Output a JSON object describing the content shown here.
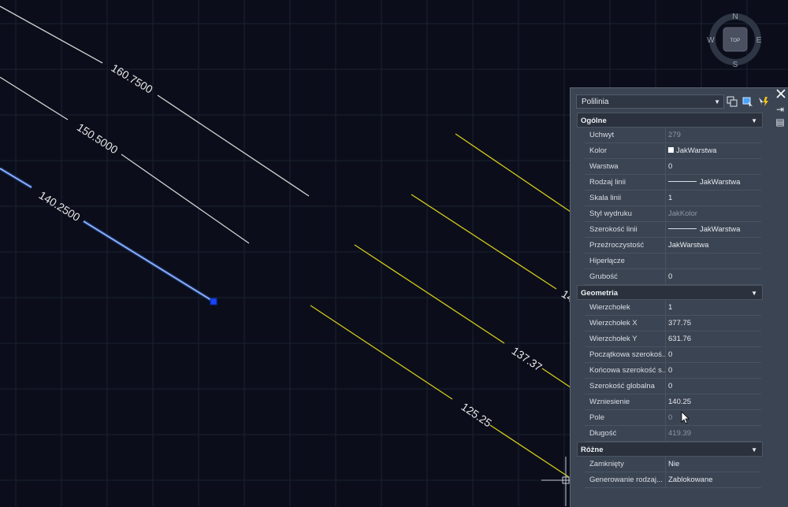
{
  "drawing": {
    "white_labels": [
      "160.7500",
      "150.5000",
      "140.2500"
    ],
    "yellow_labels": [
      "137.37",
      "125.25",
      "14"
    ]
  },
  "viewcube": {
    "north": "N",
    "south": "S",
    "east": "E",
    "west": "W",
    "face": "TOP"
  },
  "palette": {
    "object_type": "Polilinia",
    "sections": [
      {
        "title": "Ogólne",
        "rows": [
          {
            "name": "Uchwyt",
            "value": "279",
            "dim": true
          },
          {
            "name": "Kolor",
            "value": "JakWarstwa",
            "swatch": "#ffffff"
          },
          {
            "name": "Warstwa",
            "value": "0"
          },
          {
            "name": "Rodzaj linii",
            "value": "JakWarstwa",
            "line": true
          },
          {
            "name": "Skala linii",
            "value": "1"
          },
          {
            "name": "Styl wydruku",
            "value": "JakKolor",
            "dim": true
          },
          {
            "name": "Szerokość linii",
            "value": "JakWarstwa",
            "line": true
          },
          {
            "name": "Przeźroczystość",
            "value": "JakWarstwa"
          },
          {
            "name": "Hiperłącze",
            "value": ""
          },
          {
            "name": "Grubość",
            "value": "0"
          }
        ]
      },
      {
        "title": "Geometria",
        "rows": [
          {
            "name": "Wierzchołek",
            "value": "1"
          },
          {
            "name": "Wierzchołek X",
            "value": "377.75"
          },
          {
            "name": "Wierzchołek Y",
            "value": "631.76"
          },
          {
            "name": "Początkowa szerokoś...",
            "value": "0"
          },
          {
            "name": "Końcowa szerokość s...",
            "value": "0"
          },
          {
            "name": "Szerokość globalna",
            "value": "0"
          },
          {
            "name": "Wzniesienie",
            "value": "140.25"
          },
          {
            "name": "Pole",
            "value": "0",
            "dim": true
          },
          {
            "name": "Długość",
            "value": "419.39",
            "dim": true
          }
        ]
      },
      {
        "title": "Różne",
        "rows": [
          {
            "name": "Zamknięty",
            "value": "Nie"
          },
          {
            "name": "Generowanie rodzaj...",
            "value": "Zablokowane"
          }
        ]
      }
    ]
  },
  "colors": {
    "background": "#0b0e1a",
    "grid": "#1c2233",
    "contour_white": "#d8d8d8",
    "contour_yellow": "#d6cc1a",
    "selected_blue": "#4d84ff"
  }
}
